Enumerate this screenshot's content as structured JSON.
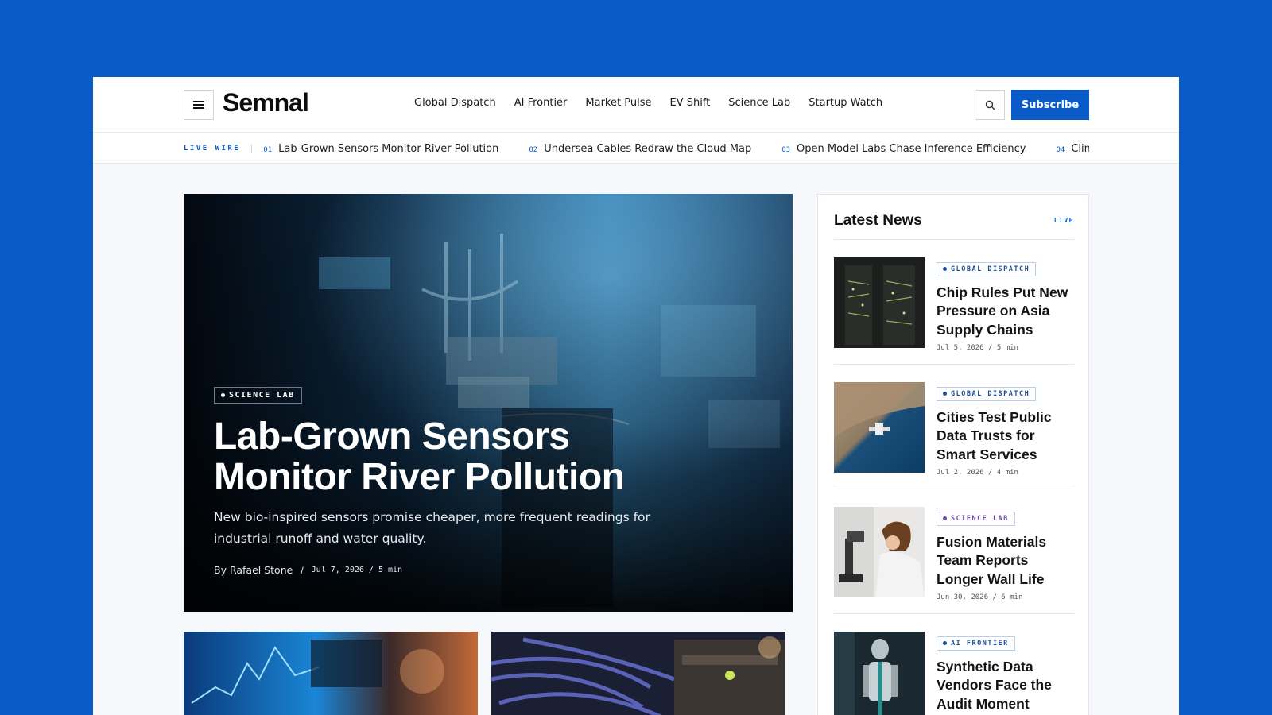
{
  "header": {
    "logo": "Semnal",
    "nav": [
      "Global Dispatch",
      "AI Frontier",
      "Market Pulse",
      "EV Shift",
      "Science Lab",
      "Startup Watch"
    ],
    "subscribe_label": "Subscribe"
  },
  "ticker": {
    "label": "LIVE WIRE",
    "items": [
      {
        "num": "01",
        "text": "Lab-Grown Sensors Monitor River Pollution"
      },
      {
        "num": "02",
        "text": "Undersea Cables Redraw the Cloud Map"
      },
      {
        "num": "03",
        "text": "Open Model Labs Chase Inference Efficiency"
      },
      {
        "num": "04",
        "text": "Climate"
      }
    ]
  },
  "hero": {
    "category": "SCIENCE LAB",
    "title_line1": "Lab-Grown Sensors",
    "title_line2": "Monitor River Pollution",
    "description": "New bio-inspired sensors promise cheaper, more frequent readings for industrial runoff and water quality.",
    "author": "By Rafael Stone",
    "separator": "/",
    "date": "Jul 7, 2026 / 5 min"
  },
  "sidebar": {
    "title": "Latest News",
    "live": "LIVE",
    "items": [
      {
        "category": "GLOBAL DISPATCH",
        "title": "Chip Rules Put New Pressure on Asia Supply Chains",
        "meta": "Jul 5, 2026 / 5 min"
      },
      {
        "category": "GLOBAL DISPATCH",
        "title": "Cities Test Public Data Trusts for Smart Services",
        "meta": "Jul 2, 2026 / 4 min"
      },
      {
        "category": "SCIENCE LAB",
        "title": "Fusion Materials Team Reports Longer Wall Life",
        "meta": "Jun 30, 2026 / 6 min"
      },
      {
        "category": "AI FRONTIER",
        "title": "Synthetic Data Vendors Face the Audit Moment",
        "meta": ""
      }
    ]
  },
  "colors": {
    "brand": "#0a5ac8",
    "background": "#f6f8fb"
  }
}
